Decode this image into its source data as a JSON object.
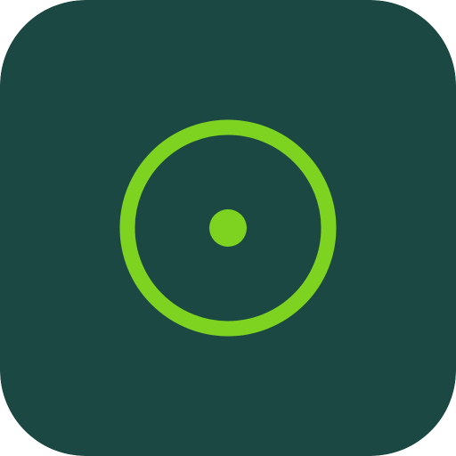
{
  "icon": {
    "name": "circle-dot-icon",
    "colors": {
      "background": "#1b4843",
      "accent": "#7ed321"
    }
  }
}
